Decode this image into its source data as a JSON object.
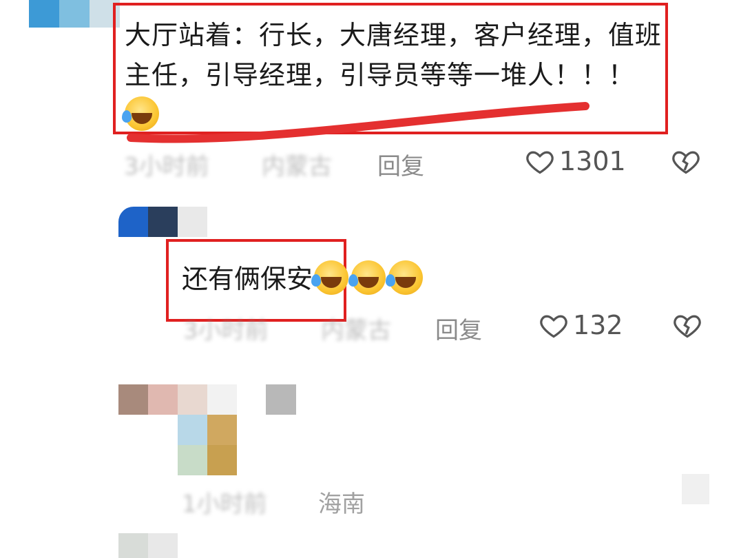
{
  "comments": [
    {
      "text": "大厅站着：行长，大唐经理，客户经理，值班主任，引导经理，引导员等等一堆人！！！",
      "emoji": "laughing-tears",
      "time": "3小时前",
      "location": "内蒙古",
      "reply_label": "回复",
      "likes": "1301"
    },
    {
      "text": "还有俩保安",
      "emoji_count": 3,
      "time": "3小时前",
      "location": "内蒙古",
      "reply_label": "回复",
      "likes": "132"
    },
    {
      "time": "1小时前",
      "location": "海南"
    }
  ],
  "colors": {
    "highlight_box": "#e02020",
    "meta_text": "#8a8a8a",
    "body_text": "#1a1a1a"
  }
}
